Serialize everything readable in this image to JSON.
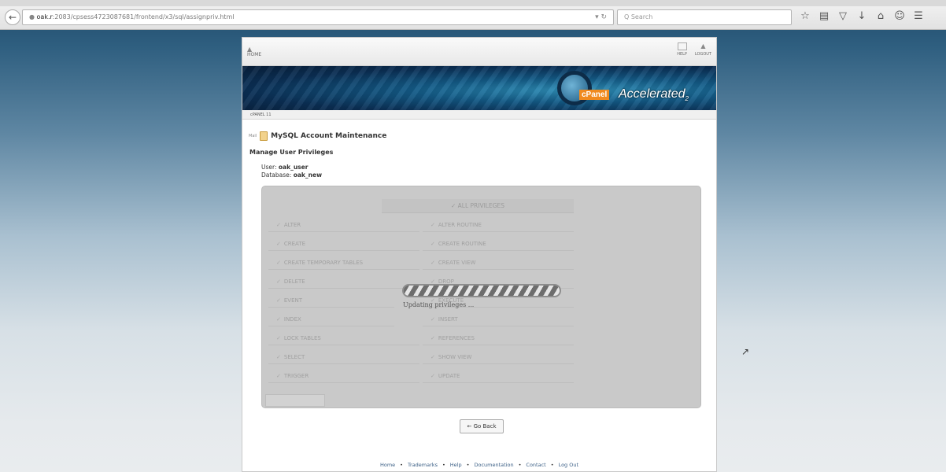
{
  "browser": {
    "url_host": "oak.r",
    "url_rest": ":2083/cpsess4723087681/frontend/x3/sql/assignpriv.html",
    "search_placeholder": "Q Search",
    "toolbar_icons": [
      "star-icon",
      "reader-icon",
      "pocket-icon",
      "download-icon",
      "home-icon",
      "smiley-icon",
      "menu-icon"
    ]
  },
  "cpanel": {
    "home_label": "HOME",
    "help_label": "HELP",
    "logout_label": "LOGOUT",
    "brand_tag": "cPanel",
    "brand_name": "Accelerated",
    "brand_sub": "2",
    "crumb": "cPANEL 11",
    "page_small": "Mail",
    "page_title": "MySQL Account Maintenance",
    "subhead": "Manage User Privileges",
    "user_label": "User:",
    "user_value": "oak_user",
    "db_label": "Database:",
    "db_value": "oak_new"
  },
  "privileges": {
    "all_label": "ALL PRIVILEGES",
    "left": [
      "ALTER",
      "CREATE",
      "CREATE TEMPORARY TABLES",
      "DELETE",
      "EVENT",
      "INDEX",
      "LOCK TABLES",
      "SELECT",
      "TRIGGER"
    ],
    "right": [
      "ALTER ROUTINE",
      "CREATE ROUTINE",
      "CREATE VIEW",
      "DROP",
      "EXECUTE",
      "INSERT",
      "REFERENCES",
      "SHOW VIEW",
      "UPDATE"
    ]
  },
  "status": {
    "updating_text": "Updating privileges ..."
  },
  "go_back_label": "← Go Back",
  "footer": [
    "Home",
    "Trademarks",
    "Help",
    "Documentation",
    "Contact",
    "Log Out"
  ]
}
